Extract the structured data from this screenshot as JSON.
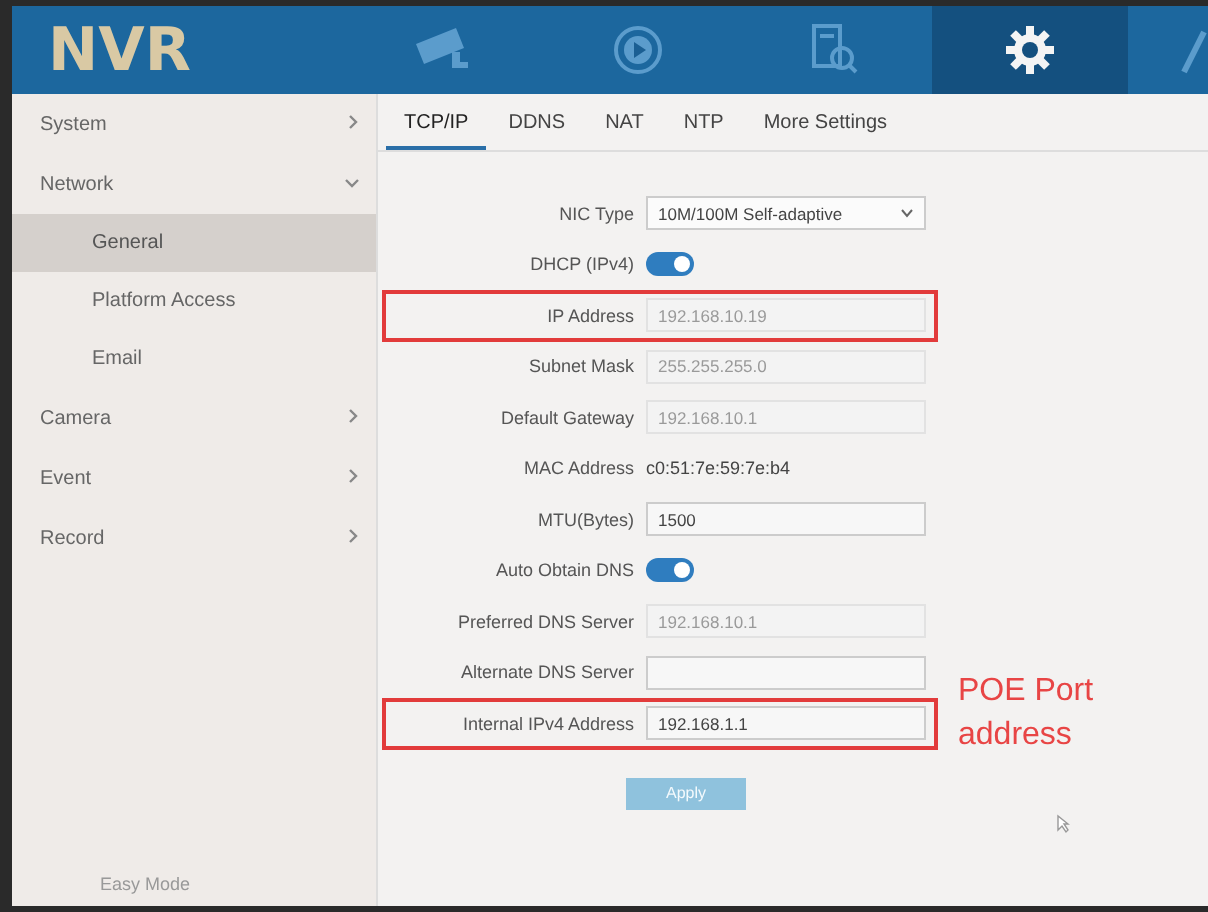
{
  "header": {
    "logo": "NVR",
    "nav": [
      {
        "kind": "camera",
        "selected": false
      },
      {
        "kind": "playback",
        "selected": false
      },
      {
        "kind": "search",
        "selected": false
      },
      {
        "kind": "settings",
        "selected": true
      },
      {
        "kind": "tools",
        "selected": false
      }
    ]
  },
  "sidebar": {
    "items": [
      {
        "label": "System",
        "selected": false,
        "expanded": false
      },
      {
        "label": "Network",
        "selected": false,
        "expanded": true,
        "children": [
          {
            "label": "General",
            "selected": true
          },
          {
            "label": "Platform Access",
            "selected": false
          },
          {
            "label": "Email",
            "selected": false
          }
        ]
      },
      {
        "label": "Camera",
        "selected": false,
        "expanded": false
      },
      {
        "label": "Event",
        "selected": false,
        "expanded": false
      },
      {
        "label": "Record",
        "selected": false,
        "expanded": false
      }
    ],
    "footer": "Easy Mode"
  },
  "tabs": [
    {
      "label": "TCP/IP",
      "selected": true
    },
    {
      "label": "DDNS",
      "selected": false
    },
    {
      "label": "NAT",
      "selected": false
    },
    {
      "label": "NTP",
      "selected": false
    },
    {
      "label": "More Settings",
      "selected": false
    }
  ],
  "form": [
    {
      "kind": "select",
      "label": "NIC Type",
      "value": "10M/100M Self-adaptive",
      "highlighted": false
    },
    {
      "kind": "toggle",
      "label": "DHCP (IPv4)",
      "on": true,
      "highlighted": false
    },
    {
      "kind": "input",
      "label": "IP Address",
      "value": "192.168.10.19",
      "disabled": true,
      "highlighted": true
    },
    {
      "kind": "input",
      "label": "Subnet Mask",
      "value": "255.255.255.0",
      "disabled": true,
      "highlighted": false
    },
    {
      "kind": "input",
      "label": "Default Gateway",
      "value": "192.168.10.1",
      "disabled": true,
      "highlighted": false
    },
    {
      "kind": "text",
      "label": "MAC Address",
      "value": "c0:51:7e:59:7e:b4",
      "highlighted": false
    },
    {
      "kind": "input",
      "label": "MTU(Bytes)",
      "value": "1500",
      "disabled": false,
      "highlighted": false
    },
    {
      "kind": "toggle",
      "label": "Auto Obtain DNS",
      "on": true,
      "highlighted": false
    },
    {
      "kind": "input",
      "label": "Preferred DNS Server",
      "value": "192.168.10.1",
      "disabled": true,
      "highlighted": false
    },
    {
      "kind": "input",
      "label": "Alternate DNS Server",
      "disabled": false,
      "highlighted": false
    },
    {
      "kind": "input",
      "label": "Internal IPv4 Address",
      "value": "192.168.1.1",
      "disabled": false,
      "highlighted": true
    }
  ],
  "apply_button": {
    "label": "Apply",
    "disabled": true
  },
  "annotation": "POE Port address"
}
